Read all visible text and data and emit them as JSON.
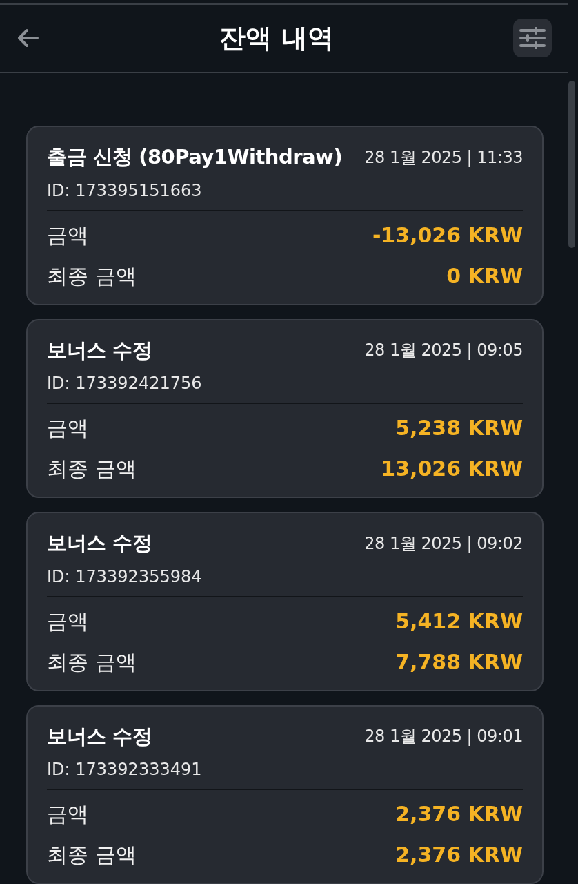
{
  "header": {
    "title": "잔액 내역"
  },
  "transactions": [
    {
      "type": "출금 신청 (80Pay1Withdraw)",
      "date": "28 1월 2025 | 11:33",
      "id": "ID: 173395151663",
      "rows": [
        {
          "label": "금액",
          "value": "-13,026 KRW"
        },
        {
          "label": "최종 금액",
          "value": "0 KRW"
        }
      ]
    },
    {
      "type": "보너스 수정",
      "date": "28 1월 2025 | 09:05",
      "id": "ID: 173392421756",
      "rows": [
        {
          "label": "금액",
          "value": "5,238 KRW"
        },
        {
          "label": "최종 금액",
          "value": "13,026 KRW"
        }
      ]
    },
    {
      "type": "보너스 수정",
      "date": "28 1월 2025 | 09:02",
      "id": "ID: 173392355984",
      "rows": [
        {
          "label": "금액",
          "value": "5,412 KRW"
        },
        {
          "label": "최종 금액",
          "value": "7,788 KRW"
        }
      ]
    },
    {
      "type": "보너스 수정",
      "date": "28 1월 2025 | 09:01",
      "id": "ID: 173392333491",
      "rows": [
        {
          "label": "금액",
          "value": "2,376 KRW"
        },
        {
          "label": "최종 금액",
          "value": "2,376 KRW"
        }
      ]
    }
  ]
}
